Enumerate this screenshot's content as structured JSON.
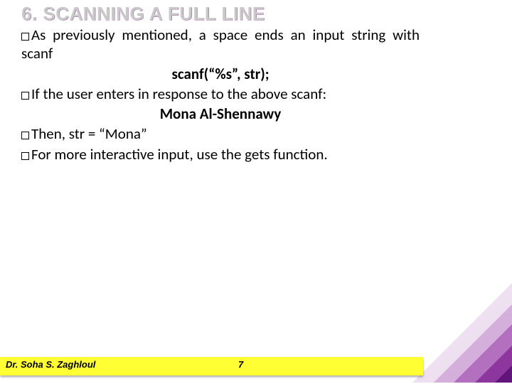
{
  "heading": "6. SCANNING A FULL LINE",
  "bullets": {
    "b1": "As previously mentioned, a space ends an input string with scanf",
    "code1": "scanf(“%s”, str);",
    "b2": "If the user enters in response to the above scanf:",
    "example_input": "Mona Al-Shennawy",
    "b3": "Then, str = “Mona”",
    "b4": "For more interactive input, use the gets function."
  },
  "footer": {
    "author": "Dr. Soha S. Zaghloul",
    "page": "7"
  },
  "colors": {
    "footer_bg": "#ffff33",
    "accent_purple": "#821496"
  }
}
